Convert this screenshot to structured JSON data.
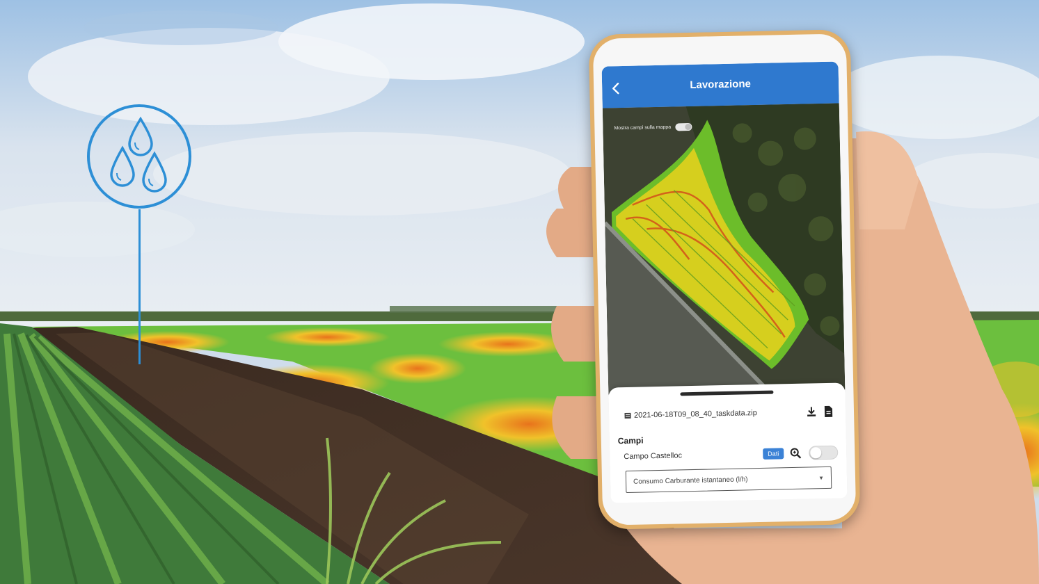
{
  "phone_app": {
    "header": {
      "title": "Lavorazione",
      "back_icon": "chevron-left-icon"
    },
    "map": {
      "toggle_label": "Mostra campi sulla mappa",
      "toggle_on": true
    },
    "file": {
      "name": "2021-06-18T09_08_40_taskdata.zip",
      "icon": "file-icon",
      "download_icon": "download-icon",
      "document_icon": "document-icon"
    },
    "fields": {
      "section_title": "Campi",
      "items": [
        {
          "name": "Campo Castelloc",
          "button_label": "Dati",
          "zoom_icon": "search-zoom-icon",
          "toggle_on": false
        }
      ],
      "layer_select": {
        "value": "Consumo Carburante istantaneo (l/h)"
      }
    }
  },
  "badge": {
    "icon": "water-drops-icon"
  },
  "colors": {
    "header_blue": "#2f79cf",
    "badge_blue": "#2d8fd6",
    "button_blue": "#3b82d6",
    "phone_gold": "#e2b06a"
  }
}
